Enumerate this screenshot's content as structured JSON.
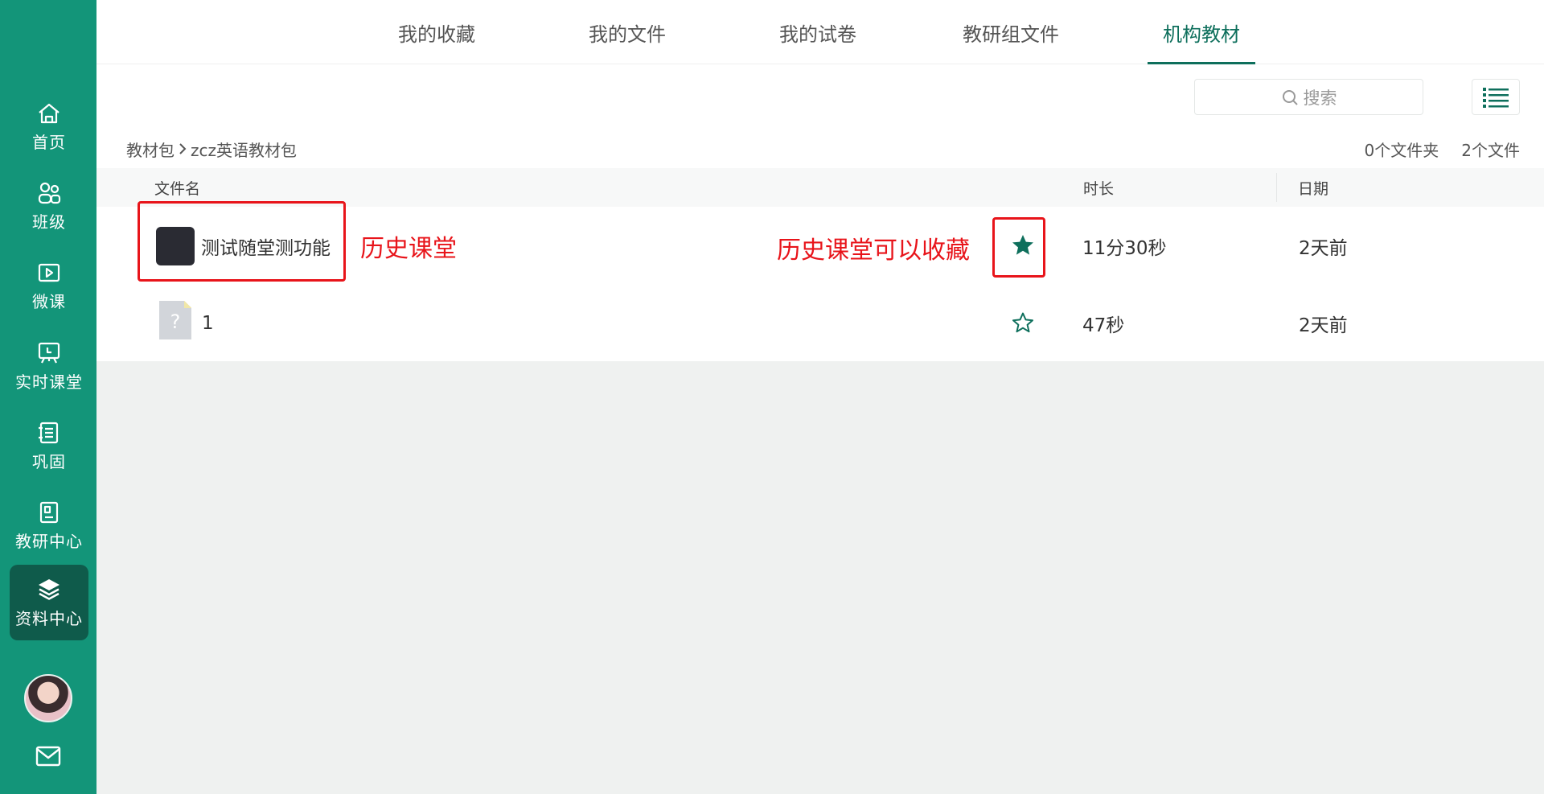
{
  "sidebar": {
    "items": [
      {
        "label": "首页",
        "icon": "home-icon"
      },
      {
        "label": "班级",
        "icon": "class-users-icon"
      },
      {
        "label": "微课",
        "icon": "micro-lesson-play-icon"
      },
      {
        "label": "实时课堂",
        "icon": "live-class-board-icon"
      },
      {
        "label": "巩固",
        "icon": "notebook-icon"
      },
      {
        "label": "教研中心",
        "icon": "research-book-icon"
      },
      {
        "label": "资料中心",
        "icon": "layers-icon",
        "active": true
      }
    ],
    "avatar": "avatar",
    "mail_icon": "mail-icon"
  },
  "tabs": [
    {
      "label": "我的收藏"
    },
    {
      "label": "我的文件"
    },
    {
      "label": "我的试卷"
    },
    {
      "label": "教研组文件"
    },
    {
      "label": "机构教材",
      "active": true
    }
  ],
  "search": {
    "placeholder": "搜索"
  },
  "breadcrumb": {
    "root": "教材包",
    "current": "zcz英语教材包"
  },
  "counts": {
    "folders": "0个文件夹",
    "files": "2个文件"
  },
  "table": {
    "headers": {
      "name": "文件名",
      "duration": "时长",
      "date": "日期"
    },
    "rows": [
      {
        "name": "测试随堂测功能",
        "favorited": true,
        "duration": "11分30秒",
        "date": "2天前",
        "thumb": "dark-thumbnail"
      },
      {
        "name": "1",
        "favorited": false,
        "duration": "47秒",
        "date": "2天前",
        "thumb": "unknown-file-icon",
        "thumb_glyph": "?"
      }
    ]
  },
  "annotations": {
    "label_history": "历史课堂",
    "label_favorite": "历史课堂可以收藏"
  },
  "colors": {
    "brand": "#139579",
    "active_side": "#0f5b4b",
    "accent": "#0e6f5c",
    "annotation": "#e8141a"
  }
}
